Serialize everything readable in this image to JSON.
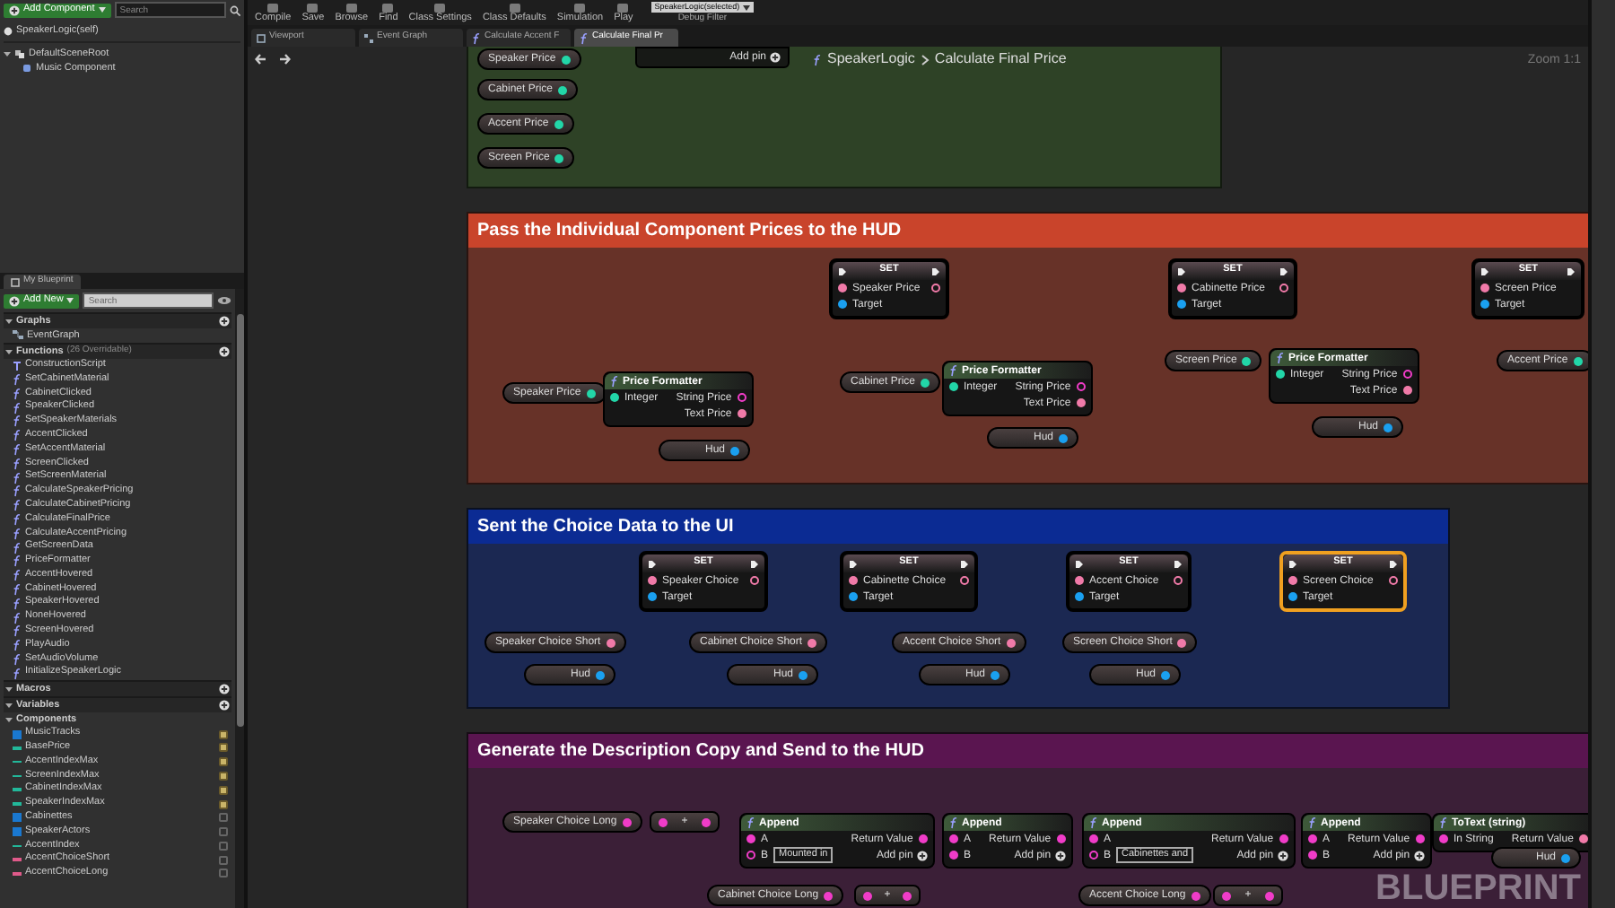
{
  "components_panel": {
    "add_button": "Add Component",
    "search": {
      "placeholder": "Search"
    },
    "self_item": "SpeakerLogic(self)",
    "tree": [
      {
        "label": "DefaultSceneRoot",
        "expanded": true,
        "children": [
          {
            "label": "Music Component"
          }
        ]
      }
    ]
  },
  "my_blueprint": {
    "tab": "My Blueprint",
    "add_button": "Add New",
    "search": {
      "placeholder": "Search"
    },
    "graphs": {
      "title": "Graphs",
      "items": [
        {
          "label": "EventGraph"
        }
      ]
    },
    "functions": {
      "title": "Functions",
      "note": "(26 Overridable)",
      "items": [
        {
          "label": "ConstructionScript",
          "kind": "construction"
        },
        {
          "label": "SetCabinetMaterial",
          "kind": "function"
        },
        {
          "label": "CabinetClicked",
          "kind": "function"
        },
        {
          "label": "SpeakerClicked",
          "kind": "function"
        },
        {
          "label": "SetSpeakerMaterials",
          "kind": "function"
        },
        {
          "label": "AccentClicked",
          "kind": "function"
        },
        {
          "label": "SetAccentMaterial",
          "kind": "function"
        },
        {
          "label": "ScreenClicked",
          "kind": "function"
        },
        {
          "label": "SetScreenMaterial",
          "kind": "function"
        },
        {
          "label": "CalculateSpeakerPricing",
          "kind": "function"
        },
        {
          "label": "CalculateCabinetPricing",
          "kind": "function"
        },
        {
          "label": "CalculateFinalPrice",
          "kind": "function"
        },
        {
          "label": "CalculateAccentPricing",
          "kind": "function"
        },
        {
          "label": "GetScreenData",
          "kind": "function"
        },
        {
          "label": "PriceFormatter",
          "kind": "function"
        },
        {
          "label": "AccentHovered",
          "kind": "function"
        },
        {
          "label": "CabinetHovered",
          "kind": "function"
        },
        {
          "label": "SpeakerHovered",
          "kind": "function"
        },
        {
          "label": "NoneHovered",
          "kind": "function"
        },
        {
          "label": "ScreenHovered",
          "kind": "function"
        },
        {
          "label": "PlayAudio",
          "kind": "function"
        },
        {
          "label": "SetAudioVolume",
          "kind": "function"
        },
        {
          "label": "InitializeSpeakerLogic",
          "kind": "function"
        }
      ]
    },
    "macros": {
      "title": "Macros"
    },
    "variables": {
      "title": "Variables",
      "group": "Components",
      "items": [
        {
          "label": "MusicTracks",
          "kind": "object",
          "public": true
        },
        {
          "label": "BasePrice",
          "kind": "integer",
          "public": true
        },
        {
          "label": "AccentIndexMax",
          "kind": "integer",
          "public": true
        },
        {
          "label": "ScreenIndexMax",
          "kind": "integer",
          "public": true
        },
        {
          "label": "CabinetIndexMax",
          "kind": "integer",
          "public": true
        },
        {
          "label": "SpeakerIndexMax",
          "kind": "integer",
          "public": true
        },
        {
          "label": "Cabinettes",
          "kind": "object",
          "public": false
        },
        {
          "label": "SpeakerActors",
          "kind": "object",
          "public": false
        },
        {
          "label": "AccentIndex",
          "kind": "integer",
          "public": false
        },
        {
          "label": "AccentChoiceShort",
          "kind": "string",
          "public": false
        },
        {
          "label": "AccentChoiceLong",
          "kind": "string",
          "public": false
        }
      ]
    }
  },
  "toolbar": {
    "items": [
      {
        "label": "Compile"
      },
      {
        "label": "Save"
      },
      {
        "label": "Browse"
      },
      {
        "label": "Find"
      },
      {
        "label": "Class Settings"
      },
      {
        "label": "Class Defaults"
      },
      {
        "label": "Simulation"
      },
      {
        "label": "Play"
      }
    ],
    "debug_filter": {
      "value": "SpeakerLogic(selected)",
      "label": "Debug Filter"
    }
  },
  "tabs": [
    {
      "label": "Viewport",
      "kind": "viewport",
      "selected": false
    },
    {
      "label": "Event Graph",
      "kind": "graph",
      "selected": false
    },
    {
      "label": "Calculate Accent F",
      "kind": "function",
      "selected": false
    },
    {
      "label": "Calculate Final Pr",
      "kind": "function",
      "selected": true
    }
  ],
  "graph": {
    "breadcrumb": [
      "SpeakerLogic",
      "Calculate Final Price"
    ],
    "zoom": "Zoom 1:1",
    "watermark": "BLUEPRINT",
    "comments": [
      {
        "color": "#2e4226",
        "nodes": [
          {
            "kind": "variable",
            "label": "Speaker Price",
            "pin": {
              "kind": "integer"
            }
          },
          {
            "kind": "variable",
            "label": "Cabinet Price",
            "pin": {
              "kind": "integer"
            }
          },
          {
            "kind": "variable",
            "label": "Accent Price",
            "pin": {
              "kind": "integer"
            }
          },
          {
            "kind": "variable",
            "label": "Screen Price",
            "pin": {
              "kind": "integer"
            }
          },
          {
            "kind": "partial",
            "footer": "Add pin"
          }
        ]
      },
      {
        "title": "Pass the Individual Component Prices to the HUD",
        "color": "#c9442b",
        "nodes": [
          {
            "kind": "variable",
            "label": "Speaker Price",
            "pin": {
              "kind": "integer"
            }
          },
          {
            "kind": "function",
            "title": "Price Formatter",
            "inputs": [
              {
                "label": "Integer",
                "kind": "integer"
              }
            ],
            "outputs": [
              {
                "label": "String Price",
                "kind": "string",
                "linked": false
              },
              {
                "label": "Text Price",
                "kind": "text",
                "linked": true
              }
            ]
          },
          {
            "kind": "variable",
            "label": "Hud",
            "pin": {
              "kind": "object"
            }
          },
          {
            "kind": "set",
            "title": "SET",
            "selected": false,
            "pins": [
              {
                "label": "Speaker Price",
                "kind": "text",
                "output": true
              },
              {
                "label": "Target",
                "kind": "object",
                "output": false
              }
            ]
          },
          {
            "kind": "variable",
            "label": "Cabinet Price",
            "pin": {
              "kind": "integer"
            }
          },
          {
            "kind": "function",
            "title": "Price Formatter",
            "inputs": [
              {
                "label": "Integer",
                "kind": "integer"
              }
            ],
            "outputs": [
              {
                "label": "String Price",
                "kind": "string",
                "linked": false
              },
              {
                "label": "Text Price",
                "kind": "text",
                "linked": true
              }
            ]
          },
          {
            "kind": "variable",
            "label": "Hud",
            "pin": {
              "kind": "object"
            }
          },
          {
            "kind": "set",
            "title": "SET",
            "selected": false,
            "pins": [
              {
                "label": "Cabinette Price",
                "kind": "text",
                "output": true
              },
              {
                "label": "Target",
                "kind": "object",
                "output": false
              }
            ]
          },
          {
            "kind": "variable",
            "label": "Screen Price",
            "pin": {
              "kind": "integer"
            }
          },
          {
            "kind": "function",
            "title": "Price Formatter",
            "inputs": [
              {
                "label": "Integer",
                "kind": "integer"
              }
            ],
            "outputs": [
              {
                "label": "String Price",
                "kind": "string",
                "linked": false
              },
              {
                "label": "Text Price",
                "kind": "text",
                "linked": true
              }
            ]
          },
          {
            "kind": "variable",
            "label": "Hud",
            "pin": {
              "kind": "object"
            }
          },
          {
            "kind": "set",
            "title": "SET",
            "selected": false,
            "pins": [
              {
                "label": "Screen Price",
                "kind": "text",
                "output": false
              },
              {
                "label": "Target",
                "kind": "object",
                "output": false
              }
            ]
          },
          {
            "kind": "variable",
            "label": "Accent Price",
            "pin": {
              "kind": "integer"
            }
          }
        ]
      },
      {
        "title": "Sent the Choice Data to the UI",
        "color": "#0b2b93",
        "nodes": [
          {
            "kind": "set",
            "title": "SET",
            "selected": false,
            "pins": [
              {
                "label": "Speaker Choice",
                "kind": "text",
                "output": true
              },
              {
                "label": "Target",
                "kind": "object",
                "output": false
              }
            ]
          },
          {
            "kind": "variable",
            "label": "Speaker Choice Short",
            "pin": {
              "kind": "text"
            }
          },
          {
            "kind": "variable",
            "label": "Hud",
            "pin": {
              "kind": "object"
            }
          },
          {
            "kind": "set",
            "title": "SET",
            "selected": false,
            "pins": [
              {
                "label": "Cabinette Choice",
                "kind": "text",
                "output": true
              },
              {
                "label": "Target",
                "kind": "object",
                "output": false
              }
            ]
          },
          {
            "kind": "variable",
            "label": "Cabinet Choice Short",
            "pin": {
              "kind": "text"
            }
          },
          {
            "kind": "variable",
            "label": "Hud",
            "pin": {
              "kind": "object"
            }
          },
          {
            "kind": "set",
            "title": "SET",
            "selected": false,
            "pins": [
              {
                "label": "Accent Choice",
                "kind": "text",
                "output": true
              },
              {
                "label": "Target",
                "kind": "object",
                "output": false
              }
            ]
          },
          {
            "kind": "variable",
            "label": "Accent Choice Short",
            "pin": {
              "kind": "text"
            }
          },
          {
            "kind": "variable",
            "label": "Hud",
            "pin": {
              "kind": "object"
            }
          },
          {
            "kind": "set",
            "title": "SET",
            "selected": true,
            "pins": [
              {
                "label": "Screen Choice",
                "kind": "text",
                "output": true
              },
              {
                "label": "Target",
                "kind": "object",
                "output": false
              }
            ]
          },
          {
            "kind": "variable",
            "label": "Screen Choice Short",
            "pin": {
              "kind": "text"
            }
          },
          {
            "kind": "variable",
            "label": "Hud",
            "pin": {
              "kind": "object"
            }
          }
        ]
      },
      {
        "title": "Generate the Description Copy and Send to the HUD",
        "color": "#5a1550",
        "nodes": [
          {
            "kind": "variable",
            "label": "Speaker Choice Long",
            "pin": {
              "kind": "string"
            }
          },
          {
            "kind": "operator",
            "label": "+",
            "pin": {
              "kind": "string"
            }
          },
          {
            "kind": "function",
            "title": "Append",
            "inputs": [
              {
                "label": "A",
                "kind": "string"
              },
              {
                "label": "B",
                "kind": "string",
                "value": "Mounted in"
              }
            ],
            "outputs": [
              {
                "label": "Return Value",
                "kind": "string",
                "linked": true
              }
            ],
            "footer": "Add pin"
          },
          {
            "kind": "function",
            "title": "Append",
            "inputs": [
              {
                "label": "A",
                "kind": "string"
              },
              {
                "label": "B",
                "kind": "string"
              }
            ],
            "outputs": [
              {
                "label": "Return Value",
                "kind": "string",
                "linked": true
              }
            ],
            "footer": "Add pin"
          },
          {
            "kind": "function",
            "title": "Append",
            "inputs": [
              {
                "label": "A",
                "kind": "string"
              },
              {
                "label": "B",
                "kind": "string",
                "value": "Cabinettes and"
              }
            ],
            "outputs": [
              {
                "label": "Return Value",
                "kind": "string",
                "linked": true
              }
            ],
            "footer": "Add pin"
          },
          {
            "kind": "function",
            "title": "Append",
            "inputs": [
              {
                "label": "A",
                "kind": "string"
              },
              {
                "label": "B",
                "kind": "string"
              }
            ],
            "outputs": [
              {
                "label": "Return Value",
                "kind": "string",
                "linked": true
              }
            ],
            "footer": "Add pin"
          },
          {
            "kind": "function",
            "title": "ToText (string)",
            "inputs": [
              {
                "label": "In String",
                "kind": "string"
              }
            ],
            "outputs": [
              {
                "label": "Return Value",
                "kind": "text",
                "linked": true
              }
            ]
          },
          {
            "kind": "variable",
            "label": "Cabinet Choice Long",
            "pin": {
              "kind": "string"
            }
          },
          {
            "kind": "operator",
            "label": "+",
            "pin": {
              "kind": "string"
            }
          },
          {
            "kind": "variable",
            "label": "Accent Choice Long",
            "pin": {
              "kind": "string"
            }
          },
          {
            "kind": "operator",
            "label": "+",
            "pin": {
              "kind": "string"
            }
          },
          {
            "kind": "variable",
            "label": "Hud",
            "pin": {
              "kind": "object"
            }
          }
        ]
      }
    ]
  }
}
